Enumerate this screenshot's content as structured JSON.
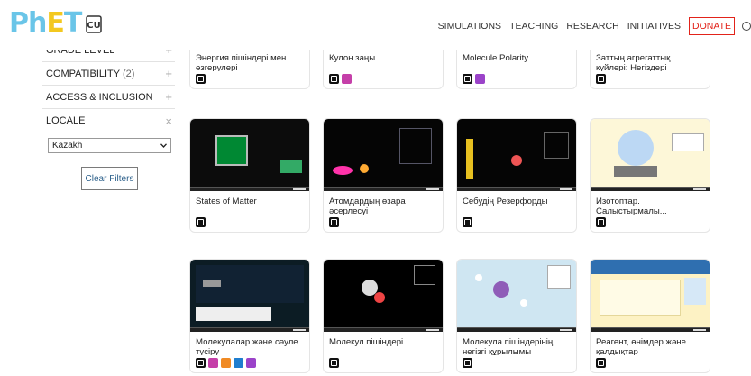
{
  "header": {
    "logo": {
      "ph": "Ph",
      "e": "E",
      "t": "T"
    },
    "nav": {
      "simulations": "SIMULATIONS",
      "teaching": "TEACHING",
      "research": "RESEARCH",
      "initiatives": "INITIATIVES",
      "donate": "DONATE"
    },
    "search_icon": "search-icon"
  },
  "sidebar": {
    "filters": [
      {
        "label": "GRADE LEVEL",
        "sign": "+"
      },
      {
        "label": "COMPATIBILITY",
        "count": "(2)",
        "sign": "+"
      },
      {
        "label": "ACCESS & INCLUSION",
        "sign": "+"
      },
      {
        "label": "LOCALE",
        "sign": "×"
      }
    ],
    "locale_value": "Kazakh",
    "clear_filters": "Clear Filters"
  },
  "cards": [
    {
      "title": "Энергия пішіндері мен өзгерулері",
      "badges": [
        "html"
      ]
    },
    {
      "title": "Кулон заңы",
      "badges": [
        "html",
        "pink"
      ]
    },
    {
      "title": "Molecule Polarity",
      "badges": [
        "html",
        "purple"
      ]
    },
    {
      "title": "Заттың агрегаттық күйлері: Негіздері",
      "badges": [
        "html"
      ]
    },
    {
      "title": "States of Matter",
      "badges": [
        "html"
      ]
    },
    {
      "title": "Атомдардың өзара әсерлесуі",
      "badges": [
        "html"
      ]
    },
    {
      "title": "Себудің Резерфорды",
      "badges": [
        "html"
      ]
    },
    {
      "title": "Изотоптар. Салыстырмалы...",
      "badges": [
        "html"
      ]
    },
    {
      "title": "Молекулалар және сәуле түсіру",
      "badges": [
        "html",
        "pink",
        "orange",
        "blue",
        "purple"
      ]
    },
    {
      "title": "Молекул пішіндері",
      "badges": [
        "html"
      ]
    },
    {
      "title": "Молекула пішіндерінің негізгі құрылымы",
      "badges": [
        "html"
      ]
    },
    {
      "title": "Реагент, өнімдер және қалдықтар",
      "badges": [
        "html"
      ]
    }
  ]
}
